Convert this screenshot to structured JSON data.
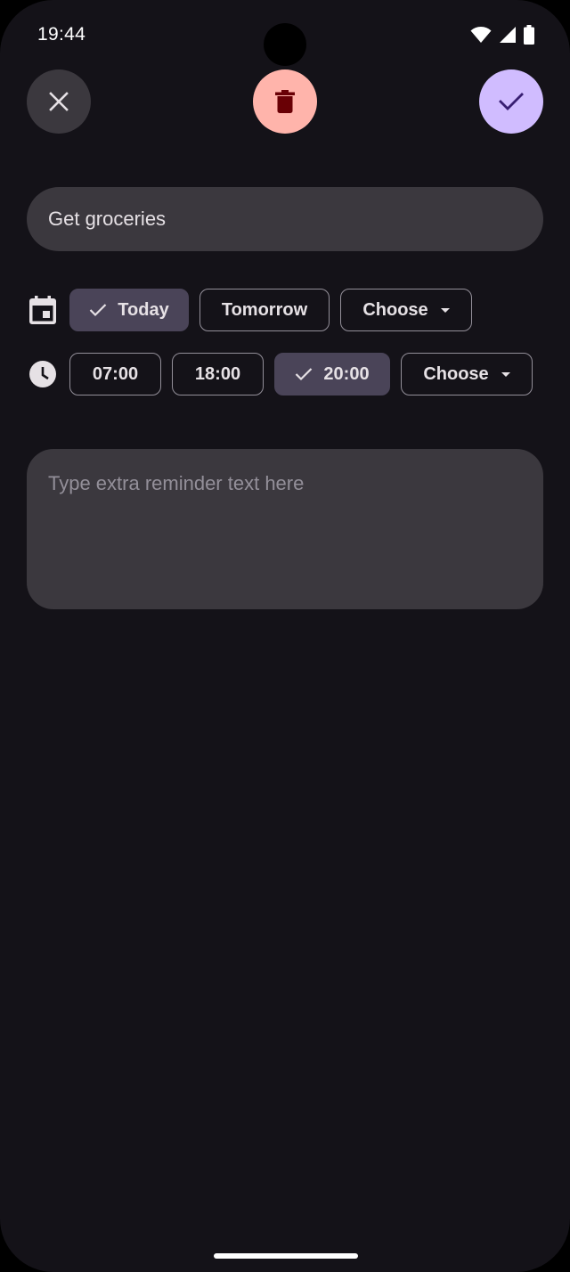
{
  "status_bar": {
    "time": "19:44"
  },
  "actions": {
    "close_icon": "close-icon",
    "delete_icon": "trash-icon",
    "save_icon": "check-icon"
  },
  "reminder": {
    "title": "Get groceries"
  },
  "date_row": {
    "icon": "calendar-icon",
    "chips": [
      {
        "label": "Today",
        "selected": true
      },
      {
        "label": "Tomorrow",
        "selected": false
      },
      {
        "label": "Choose",
        "dropdown": true
      }
    ]
  },
  "time_row": {
    "icon": "clock-icon",
    "chips": [
      {
        "label": "07:00",
        "selected": false
      },
      {
        "label": "18:00",
        "selected": false
      },
      {
        "label": "20:00",
        "selected": true
      },
      {
        "label": "Choose",
        "dropdown": true
      }
    ]
  },
  "notes": {
    "placeholder": "Type extra reminder text here"
  },
  "colors": {
    "background": "#141218",
    "field": "#3b383e",
    "delete": "#ffb4ab",
    "save": "#d0bcff",
    "selected_chip": "#4a4458"
  }
}
